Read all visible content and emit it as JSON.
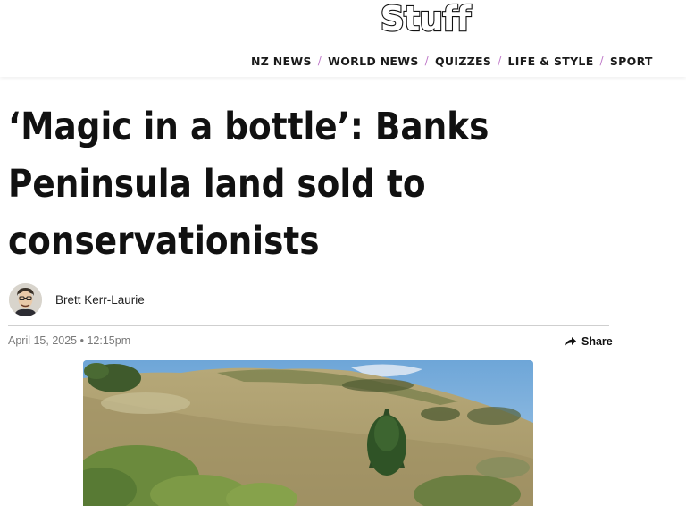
{
  "header": {
    "logo_text": "Stuff",
    "nav": [
      {
        "label": "NZ NEWS"
      },
      {
        "label": "WORLD NEWS"
      },
      {
        "label": "QUIZZES"
      },
      {
        "label": "LIFE & STYLE"
      },
      {
        "label": "SPORT"
      }
    ],
    "nav_separator": "/"
  },
  "article": {
    "headline_lines": [
      "‘Magic in a bottle’: Banks",
      "Peninsula land sold to",
      "conservationists"
    ],
    "author": {
      "name": "Brett Kerr-Laurie",
      "avatar_icon": "author-avatar"
    },
    "date": "April 15, 2025 • 12:15pm",
    "share_label": "Share",
    "share_icon": "share-arrow-icon",
    "hero_image": "hillside-landscape-photo"
  },
  "colors": {
    "nav_separator": "#c07ac9",
    "divider": "#cfcfcf",
    "meta_text": "#7a7a7a"
  }
}
